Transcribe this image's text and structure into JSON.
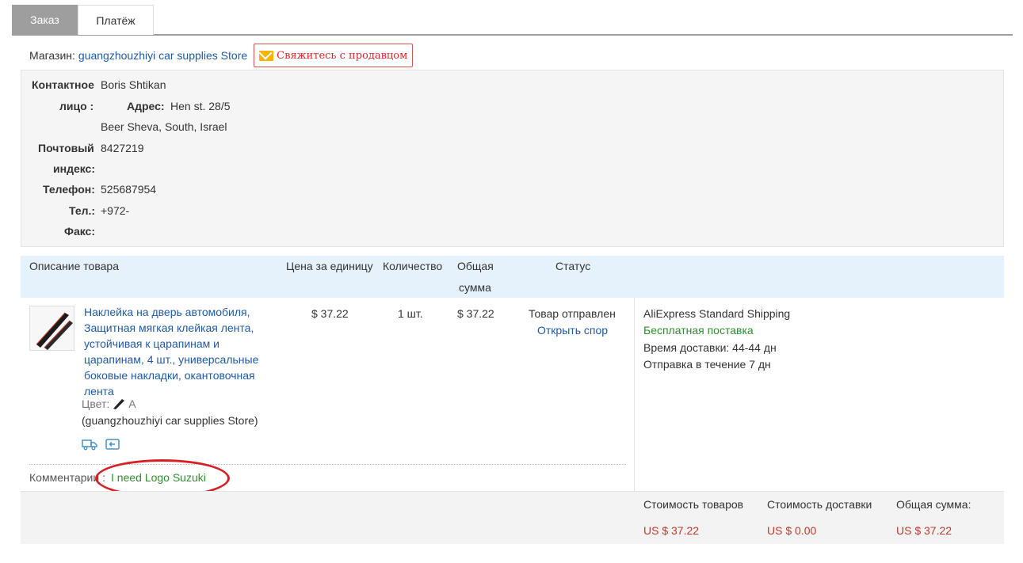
{
  "tabs": {
    "order": "Заказ",
    "payment": "Платёж"
  },
  "store": {
    "label": "Магазин:",
    "name": "guangzhouzhiyi car supplies Store",
    "contact_button": "Свяжитесь с продавцом"
  },
  "address": {
    "contact_label_1": "Контактное",
    "contact_label_2": "лицо :",
    "contact_value": "Boris Shtikan",
    "addr_label": "Адрес:",
    "addr_line1": "Hen st. 28/5",
    "addr_line2": "Beer Sheva, South, Israel",
    "zip_label_1": "Почтовый",
    "zip_label_2": "индекс:",
    "zip_value": "8427219",
    "phone_label": "Телефон:",
    "phone_value": "525687954",
    "tel_label": "Тел.:",
    "tel_value": "+972-",
    "fax_label": "Факс:"
  },
  "table": {
    "col_desc": "Описание товара",
    "col_price": "Цена за единицу",
    "col_qty": "Количество",
    "col_sum_1": "Общая",
    "col_sum_2": "сумма",
    "col_status": "Статус"
  },
  "item": {
    "title_lines": [
      "Наклейка на дверь автомобиля,",
      "Защитная мягкая клейкая лента,",
      "устойчивая к царапинам и",
      "царапинам, 4 шт., универсальные",
      "боковые накладки, окантовочная",
      "лента"
    ],
    "color_label": "Цвет:",
    "color_value": "A",
    "store_paren": "(guangzhouzhiyi car supplies Store)",
    "unit_price": "$ 37.22",
    "quantity": "1 шт.",
    "total": "$ 37.22",
    "status": "Товар отправлен",
    "dispute": "Открыть спор"
  },
  "shipping": {
    "method": "AliExpress Standard Shipping",
    "free": "Бесплатная поставка",
    "delivery_time": "Время доставки:  44-44 дн",
    "dispatch": "Отправка в течение  7 дн"
  },
  "comment": {
    "label": "Комментарии :",
    "value": "I need Logo Suzuki"
  },
  "totals": {
    "goods_label": "Стоимость товаров",
    "goods_value": "US $ 37.22",
    "ship_label": "Стоимость доставки",
    "ship_value": "US $ 0.00",
    "sum_label": "Общая сумма:",
    "sum_value": "US $ 37.22"
  }
}
